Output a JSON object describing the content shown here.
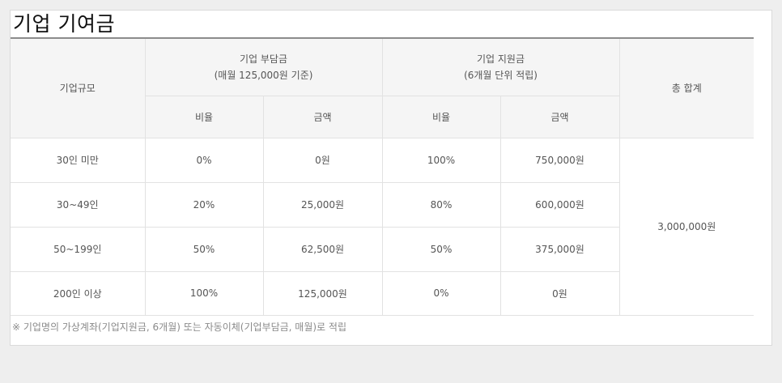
{
  "title": "기업 기여금",
  "headers": {
    "size": "기업규모",
    "burden": "기업 부담금",
    "burden_sub": "(매월 125,000원 기준)",
    "support": "기업 지원금",
    "support_sub": "(6개월 단위 적립)",
    "total": "총 합계",
    "ratio": "비율",
    "amount": "금액"
  },
  "rows": [
    {
      "size": "30인 미만",
      "burden_ratio": "0%",
      "burden_amount": "0원",
      "support_ratio": "100%",
      "support_amount": "750,000원"
    },
    {
      "size": "30~49인",
      "burden_ratio": "20%",
      "burden_amount": "25,000원",
      "support_ratio": "80%",
      "support_amount": "600,000원"
    },
    {
      "size": "50~199인",
      "burden_ratio": "50%",
      "burden_amount": "62,500원",
      "support_ratio": "50%",
      "support_amount": "375,000원"
    },
    {
      "size": "200인 이상",
      "burden_ratio": "100%",
      "burden_amount": "125,000원",
      "support_ratio": "0%",
      "support_amount": "0원"
    }
  ],
  "total_value": "3,000,000원",
  "note": "※ 기업명의 가상계좌(기업지원금, 6개월) 또는 자동이체(기업부담금, 매월)로 적립"
}
